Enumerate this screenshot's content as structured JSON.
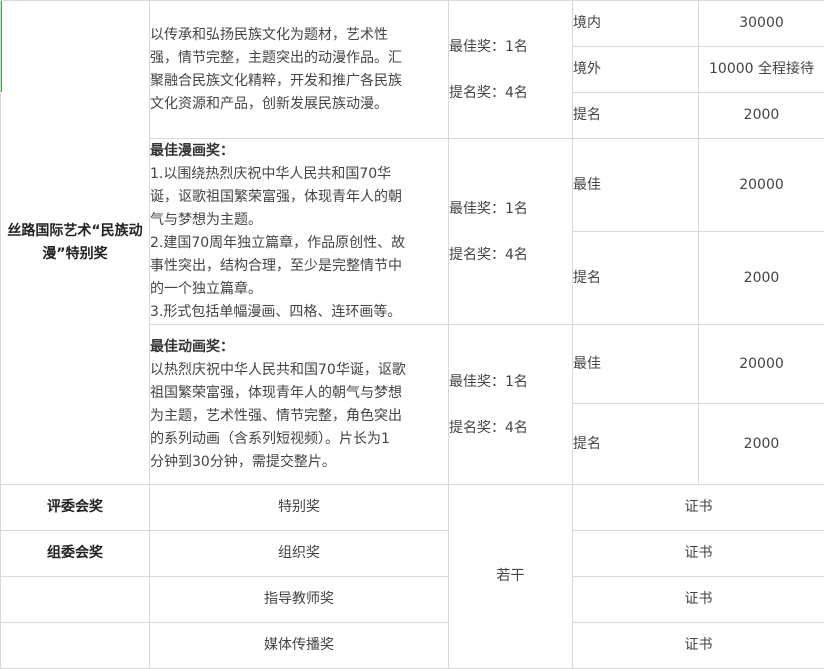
{
  "colors": {
    "accent_bar": "#3aa53a",
    "border": "#d9d9d9",
    "text": "#444444"
  },
  "category_main": "丝路国际艺术“民族动漫”特别奖",
  "section1": {
    "desc_lines": [
      "以传承和弘扬民族文化为题材，艺术性",
      "强，情节完整，主题突出的动漫作品。汇",
      "聚融合民族文化精粹，开发和推广各民族",
      "文化资源和产品，创新发展民族动漫。"
    ],
    "count_best": "最佳奖：1名",
    "count_nominee": "提名奖：4名",
    "rows": [
      {
        "label": "境内",
        "value": "30000"
      },
      {
        "label": "境外",
        "value": "10000 全程接待"
      },
      {
        "label": "提名",
        "value": "2000"
      }
    ]
  },
  "section2": {
    "title": "最佳漫画奖：",
    "desc_lines": [
      "1.以围绕热烈庆祝中华人民共和国70华",
      "诞，讴歌祖国繁荣富强，体现青年人的朝",
      "气与梦想为主题。",
      "2.建国70周年独立篇章，作品原创性、故",
      "事性突出，结构合理，至少是完整情节中",
      "的一个独立篇章。",
      "3.形式包括单幅漫画、四格、连环画等。"
    ],
    "count_best": "最佳奖：1名",
    "count_nominee": "提名奖：4名",
    "rows": [
      {
        "label": "最佳",
        "value": "20000"
      },
      {
        "label": "提名",
        "value": "2000"
      }
    ]
  },
  "section3": {
    "title": "最佳动画奖：",
    "desc_lines": [
      "以热烈庆祝中华人民共和国70华诞，讴歌",
      "祖国繁荣富强，体现青年人的朝气与梦想",
      "为主题，艺术性强、情节完整，角色突出",
      "的系列动画（含系列短视频）。片长为1",
      "分钟到30分钟，需提交整片。"
    ],
    "count_best": "最佳奖：1名",
    "count_nominee": "提名奖：4名",
    "rows": [
      {
        "label": "最佳",
        "value": "20000"
      },
      {
        "label": "提名",
        "value": "2000"
      }
    ]
  },
  "lower": {
    "count_all": "若干",
    "rows": [
      {
        "category": "评委会奖",
        "award": "特别奖",
        "prize": "证书"
      },
      {
        "category": "组委会奖",
        "award": "组织奖",
        "prize": "证书"
      },
      {
        "category": "",
        "award": "指导教师奖",
        "prize": "证书"
      },
      {
        "category": "",
        "award": "媒体传播奖",
        "prize": "证书"
      }
    ]
  }
}
